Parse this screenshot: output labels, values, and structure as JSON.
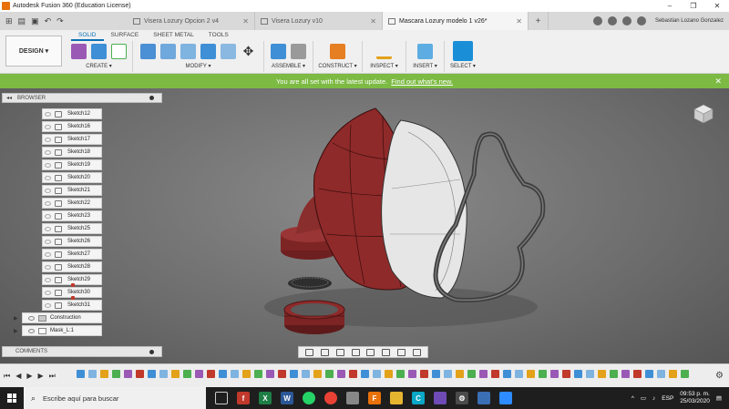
{
  "window": {
    "title": "Autodesk Fusion 360 (Education License)"
  },
  "tabs": [
    {
      "label": "Visera Lozury Opcion 2 v4",
      "active": false
    },
    {
      "label": "Visera Lozury v10",
      "active": false
    },
    {
      "label": "Mascara Lozury modelo 1 v26*",
      "active": true
    }
  ],
  "user": {
    "name": "Sebastian Lozano Gonzalez"
  },
  "toolbar": {
    "workspace": "DESIGN ▾",
    "workspace_tabs": [
      "SOLID",
      "SURFACE",
      "SHEET METAL",
      "TOOLS"
    ],
    "groups": [
      {
        "label": "CREATE ▾"
      },
      {
        "label": "MODIFY ▾"
      },
      {
        "label": "ASSEMBLE ▾"
      },
      {
        "label": "CONSTRUCT ▾"
      },
      {
        "label": "INSPECT ▾"
      },
      {
        "label": "INSERT ▾"
      },
      {
        "label": "SELECT ▾"
      }
    ]
  },
  "banner": {
    "text": "You are all set with the latest update.",
    "link": "Find out what's new."
  },
  "browser": {
    "title": "BROWSER",
    "sketches": [
      "Sketch12",
      "Sketch16",
      "Sketch17",
      "Sketch18",
      "Sketch19",
      "Sketch20",
      "Sketch21",
      "Sketch22",
      "Sketch23",
      "Sketch25",
      "Sketch26",
      "Sketch27",
      "Sketch28",
      "Sketch29",
      "Sketch30",
      "Sketch31"
    ],
    "folders": [
      "Construction",
      "Mask_L:1"
    ]
  },
  "comments": {
    "title": "COMMENTS"
  },
  "taskbar": {
    "search_placeholder": "Escribe aquí para buscar",
    "lang": "ESP",
    "time": "09:53 p. m.",
    "date": "25/03/2020"
  },
  "colors": {
    "accent": "#0a6fb5",
    "banner": "#7cba43",
    "mask_red": "#8f2a2a"
  }
}
